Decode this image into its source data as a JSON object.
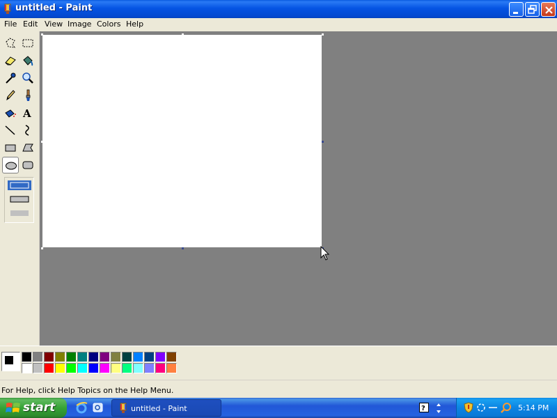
{
  "window": {
    "title": "untitled - Paint"
  },
  "menu": {
    "items": [
      "File",
      "Edit",
      "View",
      "Image",
      "Colors",
      "Help"
    ]
  },
  "toolbox": {
    "tools": [
      "free-form-select-icon",
      "select-icon",
      "eraser-icon",
      "fill-bucket-icon",
      "pick-color-icon",
      "magnifier-icon",
      "pencil-icon",
      "brush-icon",
      "airbrush-icon",
      "text-icon",
      "line-icon",
      "curve-icon",
      "rectangle-icon",
      "polygon-icon",
      "ellipse-icon",
      "rounded-rectangle-icon"
    ],
    "active_tool": "ellipse-icon",
    "fill_options": [
      "outline",
      "outline-fill",
      "fill-only"
    ],
    "selected_fill_option": "outline"
  },
  "palette": {
    "foreground": "#000000",
    "background": "#ffffff",
    "top_row": [
      "#000000",
      "#808080",
      "#800000",
      "#808000",
      "#008000",
      "#008080",
      "#000080",
      "#800080",
      "#808040",
      "#004040",
      "#0080ff",
      "#004080",
      "#8000ff",
      "#804000"
    ],
    "bottom_row": [
      "#ffffff",
      "#c0c0c0",
      "#ff0000",
      "#ffff00",
      "#00ff00",
      "#00ffff",
      "#0000ff",
      "#ff00ff",
      "#ffff80",
      "#00ff80",
      "#80ffff",
      "#8080ff",
      "#ff0080",
      "#ff8040"
    ]
  },
  "statusbar": {
    "help_text": "For Help, click Help Topics on the Help Menu."
  },
  "taskbar": {
    "start_label": "start",
    "task_label": "untitled - Paint",
    "clock": "5:14 PM"
  }
}
